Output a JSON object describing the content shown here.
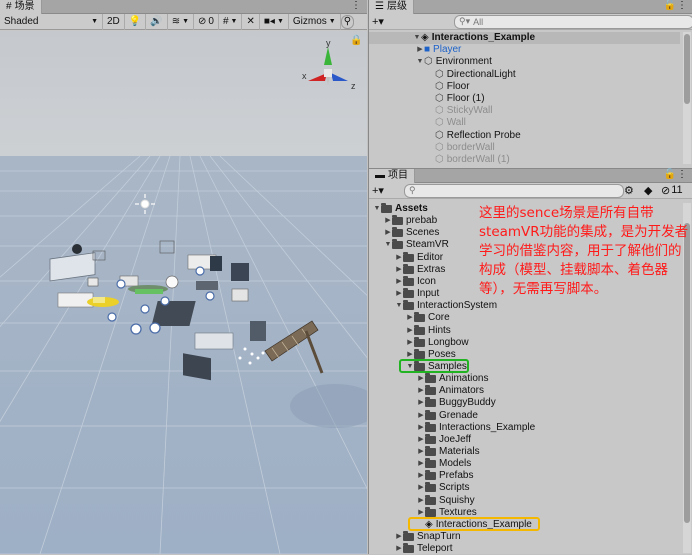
{
  "scene": {
    "tab_label": "场景",
    "shading_mode": "Shaded",
    "mode_2d": "2D",
    "hidden_count": "0",
    "gizmos_label": "Gizmos",
    "axis_y": "y",
    "axis_x": "x",
    "axis_z": "z"
  },
  "hierarchy": {
    "tab_label": "层级",
    "search_placeholder": "All",
    "rows": [
      {
        "label": "Interactions_Example",
        "indent": 0,
        "expanded": true,
        "icon": "unity-scene-icon",
        "bold": true,
        "dim": false
      },
      {
        "label": "Player",
        "indent": 1,
        "expanded": false,
        "icon": "prefab-cube-icon",
        "bold": false,
        "dim": false,
        "prefab": true
      },
      {
        "label": "Environment",
        "indent": 1,
        "expanded": true,
        "icon": "gameobject-cube-icon",
        "bold": false,
        "dim": false
      },
      {
        "label": "DirectionalLight",
        "indent": 2,
        "icon": "gameobject-cube-icon",
        "dim": false
      },
      {
        "label": "Floor",
        "indent": 2,
        "icon": "gameobject-cube-icon",
        "dim": false
      },
      {
        "label": "Floor (1)",
        "indent": 2,
        "icon": "gameobject-cube-icon",
        "dim": false
      },
      {
        "label": "StickyWall",
        "indent": 2,
        "icon": "gameobject-cube-icon",
        "dim": true
      },
      {
        "label": "Wall",
        "indent": 2,
        "icon": "gameobject-cube-icon",
        "dim": true
      },
      {
        "label": "Reflection Probe",
        "indent": 2,
        "icon": "gameobject-cube-icon",
        "dim": false
      },
      {
        "label": "borderWall",
        "indent": 2,
        "icon": "gameobject-cube-icon",
        "dim": true
      },
      {
        "label": "borderWall (1)",
        "indent": 2,
        "icon": "gameobject-cube-icon",
        "dim": true
      }
    ]
  },
  "project": {
    "tab_label": "项目",
    "hidden_count": "11",
    "rows": [
      {
        "label": "Assets",
        "indent": 0,
        "arrow": "open",
        "bold": true
      },
      {
        "label": "prebab",
        "indent": 1,
        "arrow": "closed"
      },
      {
        "label": "Scenes",
        "indent": 1,
        "arrow": "closed"
      },
      {
        "label": "SteamVR",
        "indent": 1,
        "arrow": "open"
      },
      {
        "label": "Editor",
        "indent": 2,
        "arrow": "closed"
      },
      {
        "label": "Extras",
        "indent": 2,
        "arrow": "closed"
      },
      {
        "label": "Icon",
        "indent": 2,
        "arrow": "closed"
      },
      {
        "label": "Input",
        "indent": 2,
        "arrow": "closed"
      },
      {
        "label": "InteractionSystem",
        "indent": 2,
        "arrow": "open"
      },
      {
        "label": "Core",
        "indent": 3,
        "arrow": "closed"
      },
      {
        "label": "Hints",
        "indent": 3,
        "arrow": "closed"
      },
      {
        "label": "Longbow",
        "indent": 3,
        "arrow": "closed"
      },
      {
        "label": "Poses",
        "indent": 3,
        "arrow": "closed"
      },
      {
        "label": "Samples",
        "indent": 3,
        "arrow": "open",
        "highlight": "green"
      },
      {
        "label": "Animations",
        "indent": 4,
        "arrow": "closed"
      },
      {
        "label": "Animators",
        "indent": 4,
        "arrow": "closed"
      },
      {
        "label": "BuggyBuddy",
        "indent": 4,
        "arrow": "closed"
      },
      {
        "label": "Grenade",
        "indent": 4,
        "arrow": "closed"
      },
      {
        "label": "Interactions_Example",
        "indent": 4,
        "arrow": "closed"
      },
      {
        "label": "JoeJeff",
        "indent": 4,
        "arrow": "closed"
      },
      {
        "label": "Materials",
        "indent": 4,
        "arrow": "closed"
      },
      {
        "label": "Models",
        "indent": 4,
        "arrow": "closed"
      },
      {
        "label": "Prefabs",
        "indent": 4,
        "arrow": "closed"
      },
      {
        "label": "Scripts",
        "indent": 4,
        "arrow": "closed"
      },
      {
        "label": "Squishy",
        "indent": 4,
        "arrow": "closed"
      },
      {
        "label": "Textures",
        "indent": 4,
        "arrow": "closed"
      },
      {
        "label": "Interactions_Example",
        "indent": 4,
        "arrow": "none",
        "file": "scene",
        "highlight": "orange"
      },
      {
        "label": "SnapTurn",
        "indent": 2,
        "arrow": "closed"
      },
      {
        "label": "Teleport",
        "indent": 2,
        "arrow": "closed"
      }
    ]
  },
  "annotation": {
    "text": "这里的sence场景是所有自带steamVR功能的集成，是为开发者学习的借鉴内容，用于了解他们的构成（模型、挂载脚本、着色器等），无需再写脚本。"
  },
  "colors": {
    "annotation_red": "#ff1a1a",
    "highlight_green": "#22b322",
    "highlight_orange": "#f5b800",
    "prefab_blue": "#1d62c9"
  }
}
